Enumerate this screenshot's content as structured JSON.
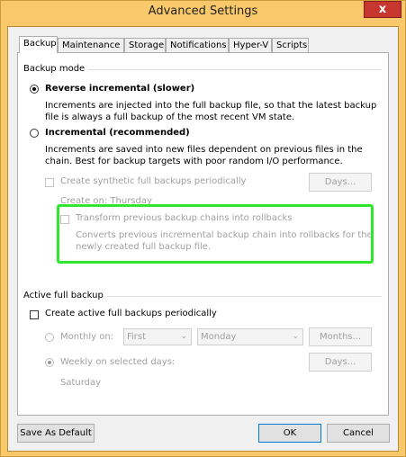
{
  "window": {
    "title": "Advanced Settings",
    "close_glyph": "x"
  },
  "tabs": [
    "Backup",
    "Maintenance",
    "Storage",
    "Notifications",
    "Hyper-V",
    "Scripts"
  ],
  "backup_mode": {
    "group_label": "Backup mode",
    "reverse_label": "Reverse incremental (slower)",
    "reverse_desc_1": "Increments are injected into the full backup file, so that the latest backup",
    "reverse_desc_2": "file is always a full backup of the most recent VM state.",
    "incremental_label": "Incremental (recommended)",
    "incremental_desc_1": "Increments are saved into new files dependent on previous files in the",
    "incremental_desc_2": "chain. Best for backup targets with poor random I/O performance.",
    "synthetic_label": "Create synthetic full backups periodically",
    "days_button": "Days...",
    "create_on": "Create on:  Thursday",
    "transform_label": "Transform previous backup chains into rollbacks",
    "transform_desc_1": "Converts previous incremental backup chain into rollbacks for the",
    "transform_desc_2": "newly created full backup file."
  },
  "active_full": {
    "group_label": "Active full backup",
    "create_label": "Create active full backups periodically",
    "monthly_label": "Monthly on:",
    "monthly_first": "First",
    "monthly_day": "Monday",
    "months_button": "Months...",
    "weekly_label": "Weekly on selected days:",
    "days_button": "Days...",
    "weekly_days": "Saturday"
  },
  "footer": {
    "save_default": "Save As Default",
    "ok": "OK",
    "cancel": "Cancel"
  },
  "colors": {
    "title_bar": "#f9c86b",
    "close": "#c7372f",
    "highlight": "#2ee82e"
  }
}
